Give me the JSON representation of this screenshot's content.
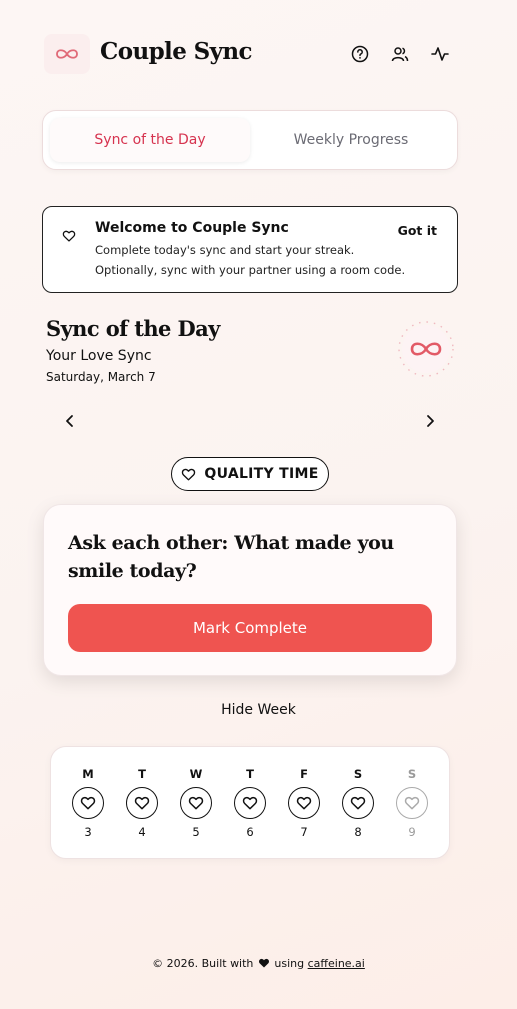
{
  "header": {
    "app_title": "Couple Sync",
    "logo_icon": "infinity-icon",
    "icons": [
      "help-circle-icon",
      "users-icon",
      "activity-icon"
    ]
  },
  "tabs": [
    {
      "label": "Sync of the Day",
      "active": true
    },
    {
      "label": "Weekly Progress",
      "active": false
    }
  ],
  "welcome": {
    "title": "Welcome to Couple Sync",
    "line1": "Complete today's sync and start your streak.",
    "line2": "Optionally, sync with your partner using a room code.",
    "dismiss_label": "Got it"
  },
  "sync": {
    "title": "Sync of the Day",
    "subtitle": "Your Love Sync",
    "date": "Saturday, March 7",
    "category": "QUALITY TIME",
    "prompt": "Ask each other: What made you smile today?",
    "complete_label": "Mark Complete"
  },
  "week": {
    "toggle_label": "Hide Week",
    "days": [
      {
        "letter": "M",
        "num": "3"
      },
      {
        "letter": "T",
        "num": "4"
      },
      {
        "letter": "W",
        "num": "5"
      },
      {
        "letter": "T",
        "num": "6"
      },
      {
        "letter": "F",
        "num": "7"
      },
      {
        "letter": "S",
        "num": "8"
      },
      {
        "letter": "S",
        "num": "9"
      }
    ]
  },
  "footer": {
    "prefix": "© 2026. Built with",
    "middle": "using",
    "link": "caffeine.ai"
  },
  "colors": {
    "accent": "#d6334f",
    "button": "#ef5450"
  }
}
